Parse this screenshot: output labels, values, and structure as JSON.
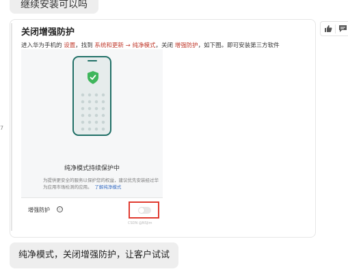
{
  "chat": {
    "top_message": "继续安装可以吗",
    "side_number": "7",
    "bottom_message": "纯净模式，关闭增强防护，让客户试试"
  },
  "card": {
    "title": "关闭增强防护",
    "desc_parts": {
      "p1": "进入华为手机的 ",
      "settings": "设置",
      "p2": "，找到 ",
      "path": "系统和更新 → 纯净模式",
      "p3": "，关闭 ",
      "enhanced": "增强防护",
      "p4": "，如下图。即可安装第三方软件"
    },
    "accent_color": "#c0392b"
  },
  "screenshot": {
    "title": "纯净模式持续保护中",
    "body": "为提供更安全的服务以保护您的权益，建议优先安装经过华为应用市场检测的应用。",
    "link": "了解纯净模式",
    "enhanced_label": "增强防护",
    "info_icon": "ⓘ",
    "toggle_state": "off",
    "highlight_color": "#e03a2f",
    "watermark": "CSDN @NSJim"
  },
  "actions": {
    "like_icon": "thumb-up-icon",
    "comment_icon": "comment-icon"
  }
}
